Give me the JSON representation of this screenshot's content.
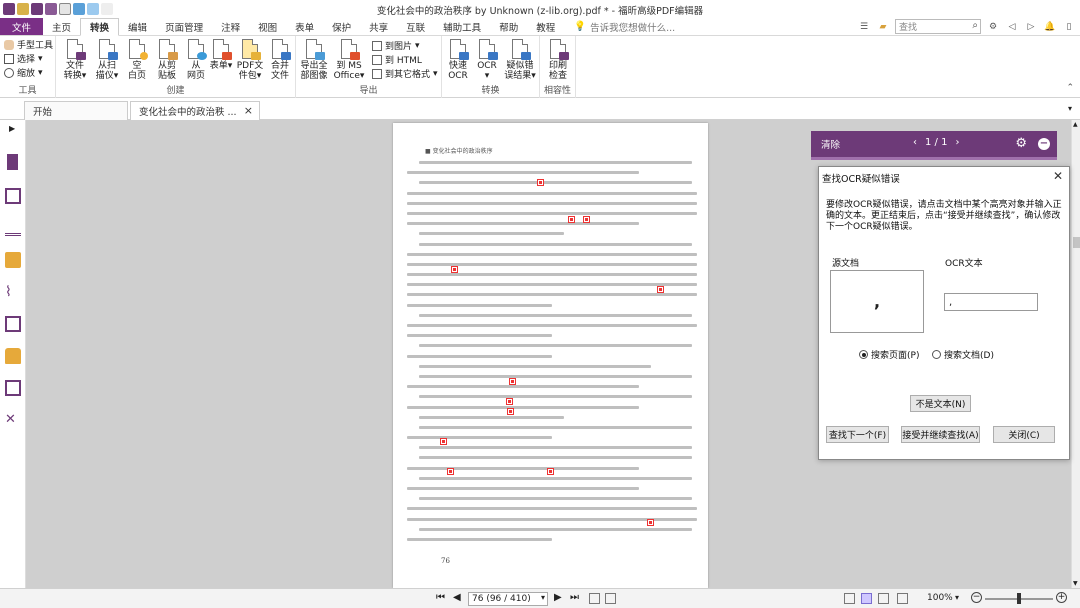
{
  "app": {
    "title": "变化社会中的政治秩序 by Unknown (z-lib.org).pdf * - 福昕高级PDF编辑器"
  },
  "ribbon_tabs": [
    "文件",
    "主页",
    "转换",
    "编辑",
    "页面管理",
    "注释",
    "视图",
    "表单",
    "保护",
    "共享",
    "互联",
    "辅助工具",
    "帮助",
    "教程"
  ],
  "active_tab": "转换",
  "tell_me": "告诉我您想做什么...",
  "search_placeholder": "查找",
  "ribbon": {
    "tools": {
      "label": "工具",
      "hand": "手型工具",
      "select": "选择",
      "zoom": "缩放"
    },
    "create": {
      "label": "创建",
      "from_file_1": "文件",
      "from_file_2": "转换",
      "from_scan_1": "从扫",
      "from_scan_2": "描仪",
      "blank_1": "空",
      "blank_2": "白页",
      "from_clip_1": "从剪",
      "from_clip_2": "贴板",
      "from_web_1": "从",
      "from_web_2": "网页",
      "form_1": "表单",
      "portfolio_1": "PDF文",
      "portfolio_2": "件包",
      "combine_1": "合并",
      "combine_2": "文件"
    },
    "export": {
      "label": "导出",
      "all_images_1": "导出全",
      "all_images_2": "部图像",
      "ms_office_1": "到 MS",
      "ms_office_2": "Office",
      "to_image": "到图片",
      "to_html": "到 HTML",
      "to_other": "到其它格式"
    },
    "convert": {
      "label": "转换",
      "quick_ocr_1": "快速",
      "quick_ocr_2": "OCR",
      "ocr_1": "OCR",
      "suspect_1": "疑似错",
      "suspect_2": "误结果"
    },
    "compat": {
      "label": "相容性",
      "print_check_1": "印刷",
      "print_check_2": "检查"
    }
  },
  "doc_tabs": {
    "start": "开始",
    "current": "变化社会中的政治秩 ..."
  },
  "pdf_page": {
    "header": "■ 变化社会中的政治秩序",
    "page_number": "76"
  },
  "ocr_bar": {
    "clear": "清除",
    "counter": "1 / 1"
  },
  "dialog": {
    "title": "查找OCR疑似错误",
    "description": "要修改OCR疑似错误，请点击文档中某个高亮对象并输入正确的文本。更正结束后，点击“接受并继续查找”，确认修改下一个OCR疑似错误。",
    "source_label": "源文档",
    "ocr_label": "OCR文本",
    "source_glyph": ",",
    "ocr_value": ",",
    "radio_page": "搜索页面(P)",
    "radio_doc": "搜索文档(D)",
    "not_text": "不是文本(N)",
    "find_next": "查找下一个(F)",
    "accept_continue": "接受并继续查找(A)",
    "close": "关闭(C)"
  },
  "status": {
    "page_field": "76 (96 / 410)",
    "zoom": "100%"
  }
}
